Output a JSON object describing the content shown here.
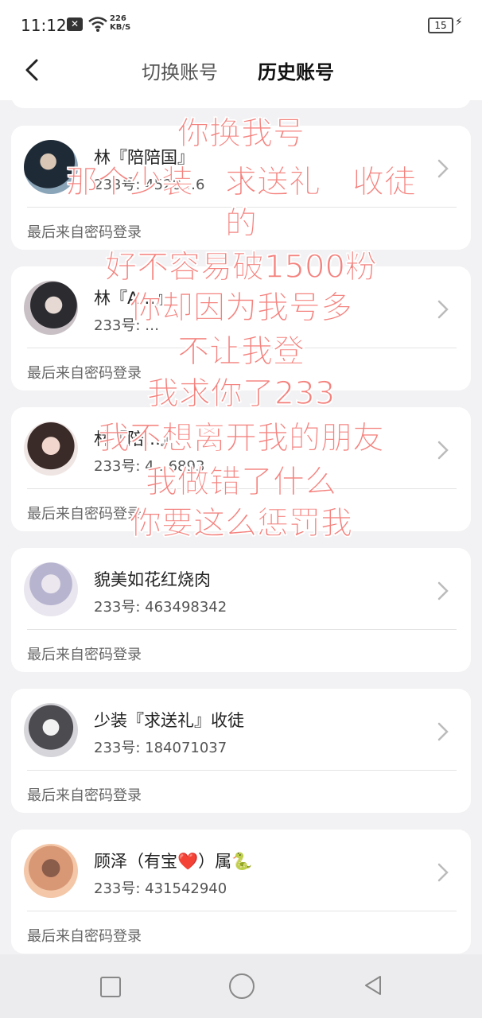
{
  "status_bar": {
    "time": "11:12",
    "net_speed_value": "226",
    "net_speed_unit": "KB/S",
    "battery": "15"
  },
  "header": {
    "tab_switch": "切换账号",
    "tab_history": "历史账号"
  },
  "accounts": [
    {
      "name": "林『陪陪国』",
      "number": "233号: 4528…6",
      "last_login": "最后来自密码登录"
    },
    {
      "name": "林『A…』",
      "number": "233号: …",
      "last_login": "最后来自密码登录"
    },
    {
      "name": "林『陪…』",
      "number": "233号: 4…6893",
      "last_login": "最后来自密码登录"
    },
    {
      "name": "貌美如花红烧肉",
      "number": "233号: 463498342",
      "last_login": "最后来自密码登录"
    },
    {
      "name": "少装『求送礼』收徒",
      "number": "233号: 184071037",
      "last_login": "最后来自密码登录"
    },
    {
      "name": "顾泽（有宝❤️）属🐍",
      "number": "233号: 431542940",
      "last_login": "最后来自密码登录"
    }
  ],
  "overlay_text": [
    "你换我号",
    "那个少装『求送礼』收徒",
    "的",
    "好不容易破1500粉",
    "你却因为我号多",
    "不让我登",
    "我求你了233",
    "我不想离开我的朋友",
    "我做错了什么",
    "你要这么惩罚我"
  ],
  "colors": {
    "accent": "#f47a10",
    "overlay_text": "#f4827e",
    "background": "#f2f2f4"
  },
  "icons": {
    "back": "chevron-left-icon",
    "row_arrow": "chevron-right-icon",
    "nav_recent": "square-icon",
    "nav_home": "circle-icon",
    "nav_back": "triangle-back-icon"
  }
}
